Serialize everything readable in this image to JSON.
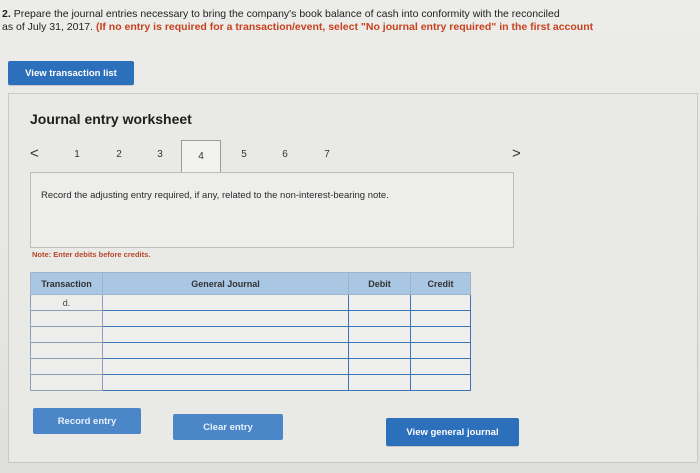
{
  "question": {
    "number": "2.",
    "line1_text": "Prepare the journal entries necessary to bring the company's book balance of cash into conformity with the reconciled",
    "line2_text": "as of July 31, 2017.",
    "line2_instruction": "(If no entry is required for a transaction/event, select \"No journal entry required\" in the first account"
  },
  "buttons": {
    "view_transaction_list": "View transaction list",
    "record_entry": "Record entry",
    "clear_entry": "Clear entry",
    "view_general_journal": "View general journal"
  },
  "worksheet": {
    "title": "Journal entry worksheet",
    "prev_arrow": "<",
    "next_arrow": ">",
    "pages": [
      "1",
      "2",
      "3",
      "4",
      "5",
      "6",
      "7"
    ],
    "active_page": "4",
    "prompt": "Record the adjusting entry required, if any, related to the non-interest-bearing note.",
    "note": "Note: Enter debits before credits."
  },
  "journal_table": {
    "headers": {
      "transaction": "Transaction",
      "general_journal": "General Journal",
      "debit": "Debit",
      "credit": "Credit"
    },
    "rows": [
      {
        "transaction": "d."
      },
      {
        "transaction": ""
      },
      {
        "transaction": ""
      },
      {
        "transaction": ""
      },
      {
        "transaction": ""
      },
      {
        "transaction": ""
      }
    ]
  }
}
